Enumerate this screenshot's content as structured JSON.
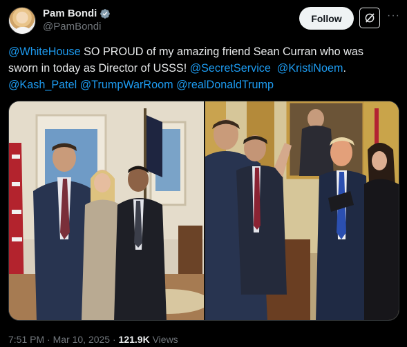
{
  "author": {
    "display_name": "Pam Bondi",
    "handle": "@PamBondi",
    "verified_icon": "verified-badge-icon"
  },
  "actions": {
    "follow_label": "Follow",
    "grok_icon": "grok-icon",
    "more_icon": "more-icon",
    "more_label": "···"
  },
  "post": {
    "mention_whitehouse": "@WhiteHouse",
    "text_1": " SO PROUD of my amazing friend Sean Curran who was sworn in today as Director of USSS! ",
    "mention_secretservice": "@SecretService",
    "space": "  ",
    "mention_kristinoem": "@KristiNoem",
    "period": ".",
    "mention_kash_patel": "@Kash_Patel",
    "mention_trumpwarroom": "@TrumpWarRoom",
    "mention_realdonaldtrump": "@realDonaldTrump"
  },
  "meta": {
    "time": "7:51 PM",
    "separator": " · ",
    "date": "Mar 10, 2025",
    "views_count": "121.9K",
    "views_label": "Views"
  },
  "colors": {
    "background": "#000000",
    "text": "#e7e9ea",
    "muted": "#71767b",
    "link": "#1d9bf0",
    "verified": "#1d9bf0"
  }
}
